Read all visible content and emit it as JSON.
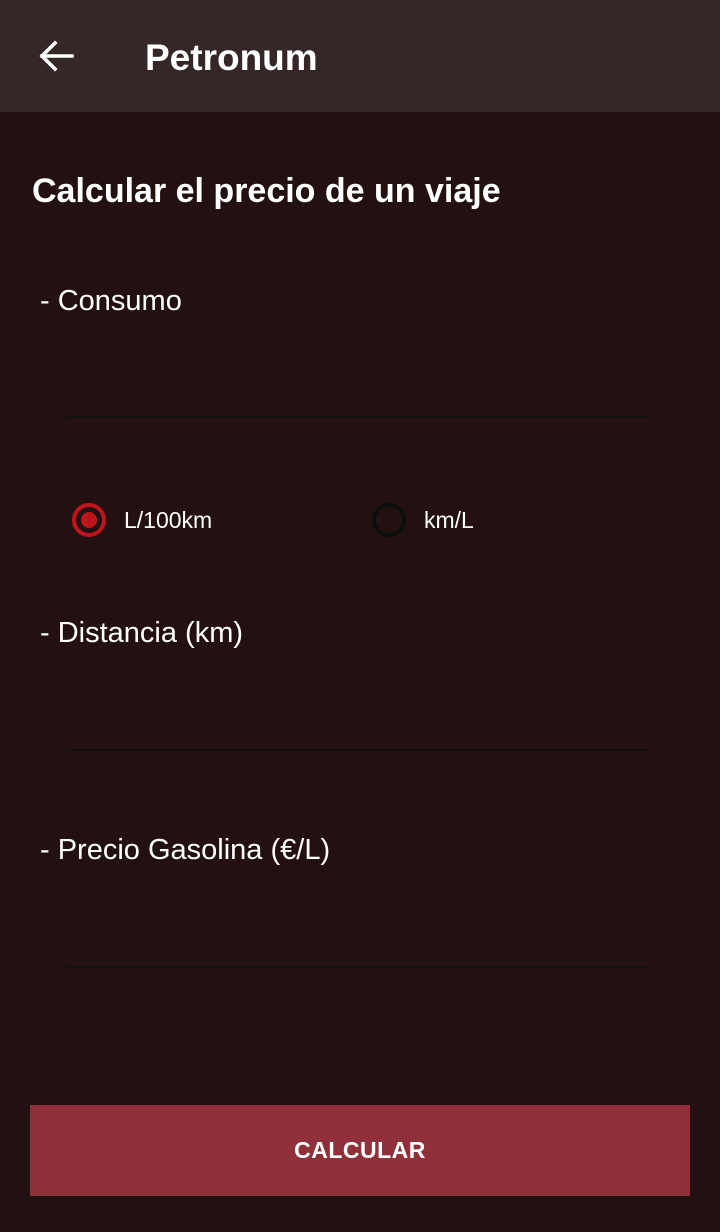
{
  "appbar": {
    "back_icon": "arrow-left-icon",
    "title": "Petronum"
  },
  "page": {
    "heading": "Calcular el precio de un viaje"
  },
  "fields": {
    "consumo": {
      "label": "- Consumo",
      "value": "",
      "placeholder": ""
    },
    "distancia": {
      "label": "- Distancia (km)",
      "value": "",
      "placeholder": ""
    },
    "precio": {
      "label": "- Precio Gasolina (€/L)",
      "value": "",
      "placeholder": ""
    }
  },
  "unit_options": [
    {
      "label": "L/100km",
      "selected": true
    },
    {
      "label": "km/L",
      "selected": false
    }
  ],
  "button": {
    "calcular_label": "CALCULAR"
  },
  "colors": {
    "background": "#231112",
    "appbar": "#352627",
    "accent": "#c0141c",
    "button": "#8f303b"
  }
}
